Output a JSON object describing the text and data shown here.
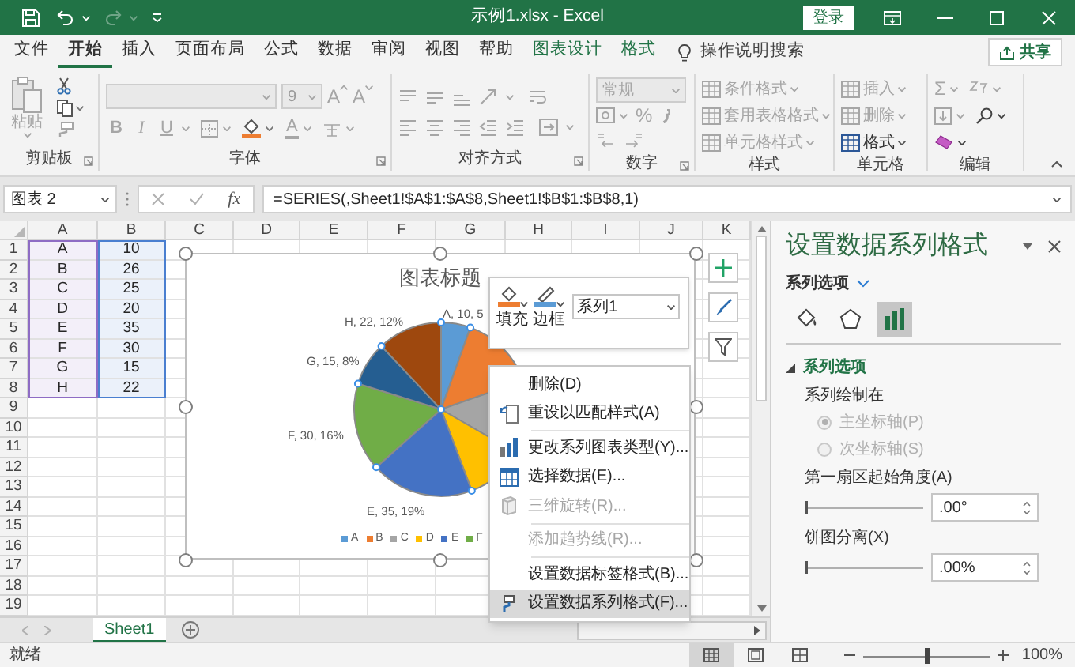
{
  "window": {
    "title": "示例1.xlsx  -  Excel",
    "sign_in": "登录"
  },
  "tabs": [
    {
      "label": "文件",
      "selected": false,
      "kind": "main"
    },
    {
      "label": "开始",
      "selected": true,
      "kind": "main"
    },
    {
      "label": "插入",
      "selected": false,
      "kind": "main"
    },
    {
      "label": "页面布局",
      "selected": false,
      "kind": "main"
    },
    {
      "label": "公式",
      "selected": false,
      "kind": "main"
    },
    {
      "label": "数据",
      "selected": false,
      "kind": "main"
    },
    {
      "label": "审阅",
      "selected": false,
      "kind": "main"
    },
    {
      "label": "视图",
      "selected": false,
      "kind": "main"
    },
    {
      "label": "帮助",
      "selected": false,
      "kind": "main"
    },
    {
      "label": "图表设计",
      "selected": false,
      "kind": "contextual"
    },
    {
      "label": "格式",
      "selected": false,
      "kind": "contextual"
    }
  ],
  "tell_me": "操作说明搜索",
  "share": "共享",
  "ribbon": [
    {
      "kind": "clipboard",
      "label": "剪贴板",
      "paste": {
        "label": "粘贴",
        "disabled": true
      }
    },
    {
      "kind": "font",
      "label": "字体",
      "font_size": "9",
      "size_buttons": [
        "A",
        "A"
      ],
      "style_buttons": [
        "B",
        "I",
        "U"
      ],
      "font_color": "A"
    },
    {
      "kind": "alignment",
      "label": "对齐方式"
    },
    {
      "kind": "number",
      "label": "数字",
      "format": "常规",
      "percent": "%"
    },
    {
      "kind": "styles",
      "label": "样式",
      "buttons": [
        {
          "label": "条件格式",
          "disabled": true
        },
        {
          "label": "套用表格格式",
          "disabled": true
        },
        {
          "label": "单元格样式",
          "disabled": true
        }
      ]
    },
    {
      "kind": "cells",
      "label": "单元格",
      "buttons": [
        {
          "label": "插入",
          "disabled": true
        },
        {
          "label": "删除",
          "disabled": true
        },
        {
          "label": "格式",
          "disabled": false
        }
      ]
    },
    {
      "kind": "editing",
      "label": "编辑",
      "sum": "Σ"
    }
  ],
  "formula_bar": {
    "name_box": "图表 2",
    "function_button": "fx",
    "formula": "=SERIES(,Sheet1!$A$1:$A$8,Sheet1!$B$1:$B$8,1)"
  },
  "sheet": {
    "columns": [
      {
        "label": "A",
        "color": "#8e6cc4"
      },
      {
        "label": "B",
        "color": "#4a7fd0"
      },
      {
        "label": "C"
      },
      {
        "label": "D"
      },
      {
        "label": "E"
      },
      {
        "label": "F"
      },
      {
        "label": "G"
      },
      {
        "label": "H"
      },
      {
        "label": "I"
      },
      {
        "label": "J"
      },
      {
        "label": "K"
      }
    ],
    "rows": [
      {
        "header": "1",
        "cells": [
          "A",
          "10"
        ]
      },
      {
        "header": "2",
        "cells": [
          "B",
          "26"
        ]
      },
      {
        "header": "3",
        "cells": [
          "C",
          "25"
        ]
      },
      {
        "header": "4",
        "cells": [
          "D",
          "20"
        ]
      },
      {
        "header": "5",
        "cells": [
          "E",
          "35"
        ]
      },
      {
        "header": "6",
        "cells": [
          "F",
          "30"
        ]
      },
      {
        "header": "7",
        "cells": [
          "G",
          "15"
        ]
      },
      {
        "header": "8",
        "cells": [
          "H",
          "22"
        ]
      },
      {
        "header": "9"
      },
      {
        "header": "10"
      },
      {
        "header": "11"
      },
      {
        "header": "12"
      },
      {
        "header": "13"
      },
      {
        "header": "14"
      },
      {
        "header": "15"
      },
      {
        "header": "16"
      },
      {
        "header": "17"
      },
      {
        "header": "18"
      },
      {
        "header": "19"
      }
    ]
  },
  "chart": {
    "title": "图表标题",
    "slice_labels": [
      "A, 10, 5",
      "H, 22, 12%",
      "G, 15, 8%",
      "F, 30, 16%",
      "E, 35, 19%"
    ],
    "legend": [
      "A",
      "B",
      "C",
      "D",
      "E",
      "F"
    ]
  },
  "mini_toolbar": {
    "fill": "填充",
    "outline": "边框",
    "series": "系列1"
  },
  "context_menu": [
    {
      "label": "删除(D)",
      "kind": "plain",
      "disabled": false,
      "selected": false,
      "separator": false
    },
    {
      "label": "重设以匹配样式(A)",
      "kind": "reset",
      "disabled": false,
      "selected": false,
      "separator": false
    },
    {
      "label": "更改系列图表类型(Y)...",
      "kind": "chart_type",
      "disabled": false,
      "selected": false,
      "separator": true
    },
    {
      "label": "选择数据(E)...",
      "kind": "select_data",
      "disabled": false,
      "selected": false,
      "separator": false
    },
    {
      "label": "三维旋转(R)...",
      "kind": "rotate",
      "disabled": true,
      "selected": false,
      "separator": false
    },
    {
      "label": "添加趋势线(R)...",
      "kind": "plain",
      "disabled": true,
      "selected": false,
      "separator": true
    },
    {
      "label": "设置数据标签格式(B)...",
      "kind": "plain",
      "disabled": false,
      "selected": false,
      "separator": true
    },
    {
      "label": "设置数据系列格式(F)...",
      "kind": "format",
      "disabled": false,
      "selected": true,
      "separator": false
    }
  ],
  "sheet_tabs": [
    {
      "label": "Sheet1",
      "selected": true
    }
  ],
  "status_bar": {
    "mode": "就绪",
    "views": [
      {
        "selected": true
      },
      {
        "selected": false
      },
      {
        "selected": false
      }
    ],
    "zoom_slider": {
      "level": 0.5
    },
    "zoom": "100%"
  },
  "pane": {
    "title": "设置数据系列格式",
    "options_menu": "系列选项",
    "icon_tabs": [
      {
        "kind": "fill",
        "selected": false
      },
      {
        "kind": "effects",
        "selected": false
      },
      {
        "kind": "options",
        "selected": true
      }
    ],
    "section": {
      "label": "系列选项",
      "expanded": true
    },
    "plot_on": "系列绘制在",
    "axes": [
      {
        "label": "主坐标轴(P)",
        "selected": true,
        "disabled": true
      },
      {
        "label": "次坐标轴(S)",
        "selected": false,
        "disabled": true
      }
    ],
    "fields": [
      {
        "label": "第一扇区起始角度(A)",
        "value": ".00°",
        "level": 0
      },
      {
        "label": "饼图分离(X)",
        "value": ".00%",
        "level": 0
      }
    ]
  }
}
